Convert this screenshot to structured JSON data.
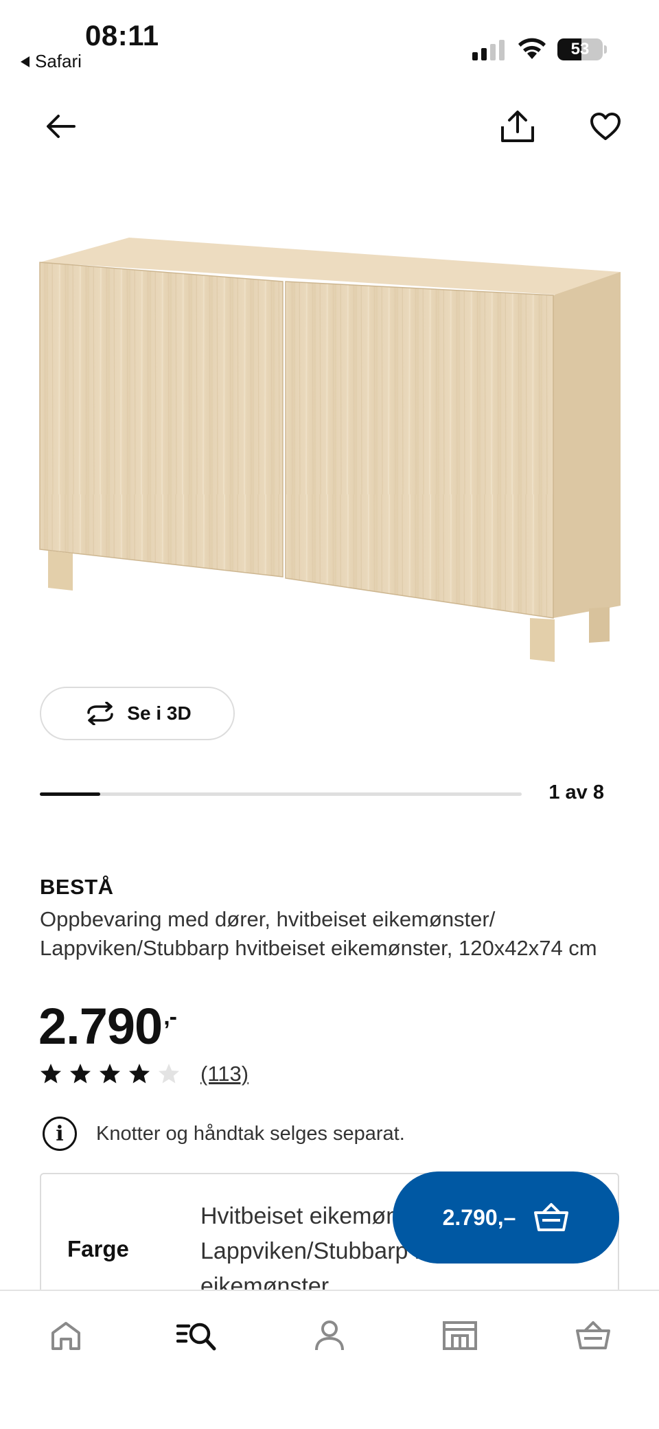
{
  "status_bar": {
    "time": "08:11",
    "back_app": "Safari",
    "battery_percent": "53",
    "battery_level": 0.53,
    "signal_bars_filled": 2,
    "signal_bars_total": 4
  },
  "header": {
    "back_icon": "arrow-left-icon",
    "share_icon": "share-icon",
    "favourite_icon": "heart-icon"
  },
  "gallery": {
    "view_3d_label": "Se i 3D",
    "view_3d_icon": "rotate-icon",
    "counter": "1 av 8",
    "progress": 0.125
  },
  "product": {
    "brand": "BESTÅ",
    "description": "Oppbevaring med dører, hvitbeiset eikemønster/ Lappviken/Stubbarp hvitbeiset eikemønster, 120x42x74 cm",
    "price_main": "2.790",
    "price_suffix": ",-",
    "rating": 4,
    "rating_max": 5,
    "review_count": "(113)",
    "info_text": "Knotter og håndtak selges separat."
  },
  "variant": {
    "label": "Farge",
    "value": "Hvitbeiset eikemønster/ Lappviken/Stubbarp hvitbeiset eikemønster"
  },
  "cart_button": {
    "label": "2.790,–",
    "icon": "basket-icon",
    "color": "#0058a3"
  },
  "bottom_nav": {
    "items": [
      {
        "name": "home",
        "icon": "home-icon"
      },
      {
        "name": "search",
        "icon": "search-icon",
        "active": true
      },
      {
        "name": "profile",
        "icon": "person-icon"
      },
      {
        "name": "store",
        "icon": "store-icon"
      },
      {
        "name": "basket",
        "icon": "basket-icon"
      }
    ]
  }
}
